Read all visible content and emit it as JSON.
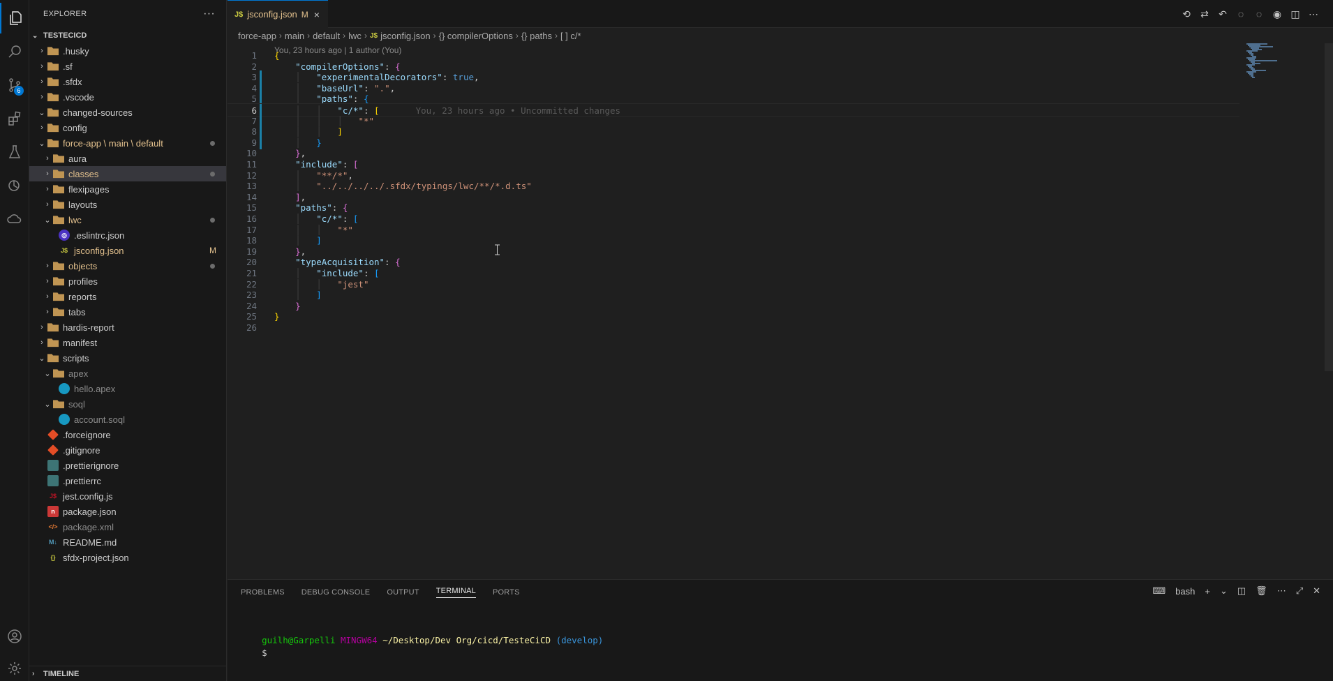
{
  "activity_bar": {
    "source_control_badge": "6",
    "items": [
      {
        "name": "explorer",
        "icon": "files-icon"
      },
      {
        "name": "search",
        "icon": "search-icon"
      },
      {
        "name": "source-control",
        "icon": "source-control-icon"
      },
      {
        "name": "extensions",
        "icon": "extensions-icon"
      },
      {
        "name": "testing",
        "icon": "beaker-icon"
      },
      {
        "name": "salesforce",
        "icon": "org-browser-icon"
      },
      {
        "name": "remote",
        "icon": "cloud-icon"
      }
    ],
    "bottom": [
      {
        "name": "accounts",
        "icon": "account-icon"
      },
      {
        "name": "manage",
        "icon": "gear-icon"
      }
    ]
  },
  "sidebar": {
    "title": "EXPLORER",
    "more": "···",
    "root": "TESTECICD",
    "timeline": "TIMELINE",
    "items": [
      {
        "label": ".husky",
        "depth": 0,
        "chev": "›",
        "icon": "husky-folder",
        "cls": ""
      },
      {
        "label": ".sf",
        "depth": 0,
        "chev": "›",
        "icon": "folder",
        "cls": ""
      },
      {
        "label": ".sfdx",
        "depth": 0,
        "chev": "›",
        "icon": "folder",
        "cls": ""
      },
      {
        "label": ".vscode",
        "depth": 0,
        "chev": "›",
        "icon": "vscode-folder",
        "cls": ""
      },
      {
        "label": "changed-sources",
        "depth": 0,
        "chev": "⌄",
        "icon": "folder",
        "cls": ""
      },
      {
        "label": "config",
        "depth": 0,
        "chev": "›",
        "icon": "config-folder",
        "cls": ""
      },
      {
        "label": "force-app \\ main \\ default",
        "depth": 0,
        "chev": "⌄",
        "icon": "folder",
        "cls": "modified",
        "dot": true
      },
      {
        "label": "aura",
        "depth": 1,
        "chev": "›",
        "icon": "folder",
        "cls": ""
      },
      {
        "label": "classes",
        "depth": 1,
        "chev": "›",
        "icon": "folder",
        "cls": "modified",
        "dot": true,
        "selected": true
      },
      {
        "label": "flexipages",
        "depth": 1,
        "chev": "›",
        "icon": "folder",
        "cls": ""
      },
      {
        "label": "layouts",
        "depth": 1,
        "chev": "›",
        "icon": "layout-folder",
        "cls": ""
      },
      {
        "label": "lwc",
        "depth": 1,
        "chev": "⌄",
        "icon": "folder",
        "cls": "modified",
        "dot": true
      },
      {
        "label": ".eslintrc.json",
        "depth": 2,
        "chev": "",
        "icon": "eslint",
        "cls": ""
      },
      {
        "label": "jsconfig.json",
        "depth": 2,
        "chev": "",
        "icon": "js",
        "cls": "modified",
        "mark": "M"
      },
      {
        "label": "objects",
        "depth": 1,
        "chev": "›",
        "icon": "folder",
        "cls": "modified",
        "dot": true
      },
      {
        "label": "profiles",
        "depth": 1,
        "chev": "›",
        "icon": "folder",
        "cls": ""
      },
      {
        "label": "reports",
        "depth": 1,
        "chev": "›",
        "icon": "folder",
        "cls": ""
      },
      {
        "label": "tabs",
        "depth": 1,
        "chev": "›",
        "icon": "folder",
        "cls": ""
      },
      {
        "label": "hardis-report",
        "depth": 0,
        "chev": "›",
        "icon": "folder",
        "cls": ""
      },
      {
        "label": "manifest",
        "depth": 0,
        "chev": "›",
        "icon": "folder",
        "cls": ""
      },
      {
        "label": "scripts",
        "depth": 0,
        "chev": "⌄",
        "icon": "scripts-folder",
        "cls": ""
      },
      {
        "label": "apex",
        "depth": 1,
        "chev": "⌄",
        "icon": "folder",
        "cls": "muted"
      },
      {
        "label": "hello.apex",
        "depth": 2,
        "chev": "",
        "icon": "apex",
        "cls": "muted"
      },
      {
        "label": "soql",
        "depth": 1,
        "chev": "⌄",
        "icon": "folder",
        "cls": "muted"
      },
      {
        "label": "account.soql",
        "depth": 2,
        "chev": "",
        "icon": "soql",
        "cls": "muted"
      },
      {
        "label": ".forceignore",
        "depth": 0,
        "chev": "",
        "icon": "git",
        "cls": ""
      },
      {
        "label": ".gitignore",
        "depth": 0,
        "chev": "",
        "icon": "git",
        "cls": ""
      },
      {
        "label": ".prettierignore",
        "depth": 0,
        "chev": "",
        "icon": "prettier",
        "cls": ""
      },
      {
        "label": ".prettierrc",
        "depth": 0,
        "chev": "",
        "icon": "prettier",
        "cls": ""
      },
      {
        "label": "jest.config.js",
        "depth": 0,
        "chev": "",
        "icon": "jest",
        "cls": ""
      },
      {
        "label": "package.json",
        "depth": 0,
        "chev": "",
        "icon": "npm",
        "cls": ""
      },
      {
        "label": "package.xml",
        "depth": 0,
        "chev": "",
        "icon": "xml",
        "cls": "muted"
      },
      {
        "label": "README.md",
        "depth": 0,
        "chev": "",
        "icon": "md",
        "cls": ""
      },
      {
        "label": "sfdx-project.json",
        "depth": 0,
        "chev": "",
        "icon": "json",
        "cls": ""
      }
    ]
  },
  "tab": {
    "icon": "J$",
    "name": "jsconfig.json",
    "status": "M",
    "close": "×"
  },
  "breadcrumb": [
    "force-app",
    "main",
    "default",
    "lwc",
    "jsconfig.json",
    "{} compilerOptions",
    "{} paths",
    "[ ] c/*"
  ],
  "codelens": "You, 23 hours ago | 1 author (You)",
  "blame": "You, 23 hours ago • Uncommitted changes",
  "current_line": 6,
  "modified_lines": [
    3,
    4,
    5,
    6,
    7,
    8,
    9
  ],
  "code_lines": [
    "{",
    "    \"compilerOptions\": {",
    "        \"experimentalDecorators\": true,",
    "        \"baseUrl\": \".\",",
    "        \"paths\": {",
    "            \"c/*\": [",
    "                \"*\"",
    "            ]",
    "        }",
    "    },",
    "    \"include\": [",
    "        \"**/*\",",
    "        \"../../../../.sfdx/typings/lwc/**/*.d.ts\"",
    "    ],",
    "    \"paths\": {",
    "        \"c/*\": [",
    "            \"*\"",
    "        ]",
    "    },",
    "    \"typeAcquisition\": {",
    "        \"include\": [",
    "            \"jest\"",
    "        ]",
    "    }",
    "}",
    ""
  ],
  "panel": {
    "tabs": [
      "PROBLEMS",
      "DEBUG CONSOLE",
      "OUTPUT",
      "TERMINAL",
      "PORTS"
    ],
    "active_tab": "TERMINAL",
    "shell": "bash",
    "terminal": {
      "user": "guilh@Garpelli",
      "host": "MINGW64",
      "path": "~/Desktop/Dev Org/cicd/TesteCiCD",
      "branch": "(develop)",
      "prompt": "$"
    }
  }
}
